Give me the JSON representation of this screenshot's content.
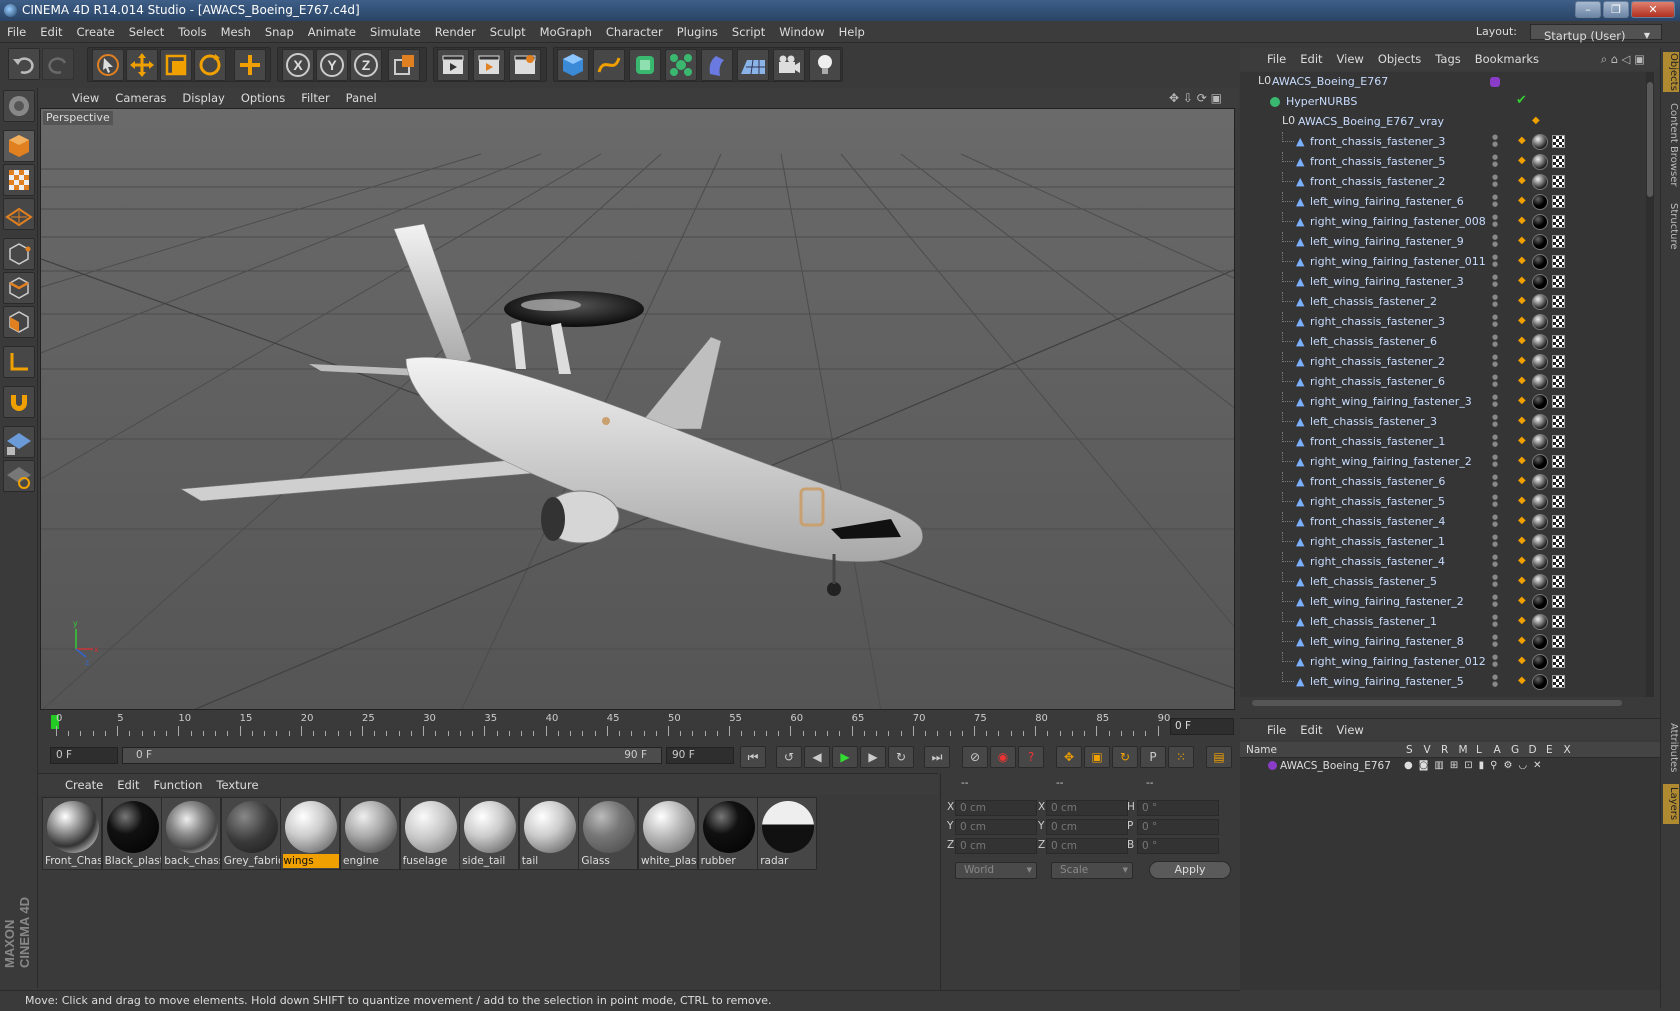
{
  "window": {
    "title": "CINEMA 4D R14.014 Studio - [AWACS_Boeing_E767.c4d]"
  },
  "menubar": {
    "items": [
      "File",
      "Edit",
      "Create",
      "Select",
      "Tools",
      "Mesh",
      "Snap",
      "Animate",
      "Simulate",
      "Render",
      "Sculpt",
      "MoGraph",
      "Character",
      "Plugins",
      "Script",
      "Window",
      "Help"
    ]
  },
  "layout": {
    "label": "Layout:",
    "value": "Startup (User)"
  },
  "viewport": {
    "menu": [
      "View",
      "Cameras",
      "Display",
      "Options",
      "Filter",
      "Panel"
    ],
    "label": "Perspective"
  },
  "timeline": {
    "ticks": [
      "0",
      "5",
      "10",
      "15",
      "20",
      "25",
      "30",
      "35",
      "40",
      "45",
      "50",
      "55",
      "60",
      "65",
      "70",
      "75",
      "80",
      "85",
      "90"
    ],
    "current_frame": "0 F"
  },
  "transport": {
    "start": "0 F",
    "range_start": "0 F",
    "range_end": "90 F",
    "end": "90 F"
  },
  "material_manager": {
    "menu": [
      "Create",
      "Edit",
      "Function",
      "Texture"
    ],
    "materials": [
      {
        "name": "Front_Chas",
        "style": "chrome"
      },
      {
        "name": "Black_plast",
        "style": "black"
      },
      {
        "name": "back_chass",
        "style": "chrome2"
      },
      {
        "name": "Grey_fabric",
        "style": "grey"
      },
      {
        "name": "wings",
        "style": "light",
        "selected": true
      },
      {
        "name": "engine",
        "style": "engine"
      },
      {
        "name": "fuselage",
        "style": "fuselage"
      },
      {
        "name": "side_tail",
        "style": "light"
      },
      {
        "name": "tail",
        "style": "light"
      },
      {
        "name": "Glass",
        "style": "glass"
      },
      {
        "name": "white_plas",
        "style": "white"
      },
      {
        "name": "rubber",
        "style": "black"
      },
      {
        "name": "radar",
        "style": "radar"
      }
    ]
  },
  "coordinates": {
    "col_headers": [
      "--",
      "--",
      "--"
    ],
    "rows": [
      {
        "a": "X",
        "av": "0 cm",
        "b": "X",
        "bv": "0 cm",
        "c": "H",
        "cv": "0 °"
      },
      {
        "a": "Y",
        "av": "0 cm",
        "b": "Y",
        "bv": "0 cm",
        "c": "P",
        "cv": "0 °"
      },
      {
        "a": "Z",
        "av": "0 cm",
        "b": "Z",
        "bv": "0 cm",
        "c": "B",
        "cv": "0 °"
      }
    ],
    "mode1": "World",
    "mode2": "Scale",
    "apply": "Apply"
  },
  "status": "Move: Click and drag to move elements. Hold down SHIFT to quantize movement / add to the selection in point mode, CTRL to remove.",
  "object_manager": {
    "menu": [
      "File",
      "Edit",
      "View",
      "Objects",
      "Tags",
      "Bookmarks"
    ],
    "root": "AWACS_Boeing_E767",
    "hypernurbs": "HyperNURBS",
    "group": "AWACS_Boeing_E767_vray",
    "children": [
      {
        "name": "front_chassis_fastener_3",
        "mat": "chrome"
      },
      {
        "name": "front_chassis_fastener_5",
        "mat": "chrome"
      },
      {
        "name": "front_chassis_fastener_2",
        "mat": "chrome"
      },
      {
        "name": "left_wing_fairing_fastener_6",
        "mat": "black"
      },
      {
        "name": "right_wing_fairing_fastener_008",
        "mat": "black"
      },
      {
        "name": "left_wing_fairing_fastener_9",
        "mat": "black"
      },
      {
        "name": "right_wing_fairing_fastener_011",
        "mat": "black"
      },
      {
        "name": "left_wing_fairing_fastener_3",
        "mat": "black"
      },
      {
        "name": "left_chassis_fastener_2",
        "mat": "chrome"
      },
      {
        "name": "right_chassis_fastener_3",
        "mat": "chrome"
      },
      {
        "name": "left_chassis_fastener_6",
        "mat": "chrome"
      },
      {
        "name": "right_chassis_fastener_2",
        "mat": "chrome"
      },
      {
        "name": "right_chassis_fastener_6",
        "mat": "chrome"
      },
      {
        "name": "right_wing_fairing_fastener_3",
        "mat": "black"
      },
      {
        "name": "left_chassis_fastener_3",
        "mat": "chrome"
      },
      {
        "name": "front_chassis_fastener_1",
        "mat": "chrome"
      },
      {
        "name": "right_wing_fairing_fastener_2",
        "mat": "black"
      },
      {
        "name": "front_chassis_fastener_6",
        "mat": "chrome"
      },
      {
        "name": "right_chassis_fastener_5",
        "mat": "chrome"
      },
      {
        "name": "front_chassis_fastener_4",
        "mat": "chrome"
      },
      {
        "name": "right_chassis_fastener_1",
        "mat": "chrome"
      },
      {
        "name": "right_chassis_fastener_4",
        "mat": "chrome"
      },
      {
        "name": "left_chassis_fastener_5",
        "mat": "chrome"
      },
      {
        "name": "left_wing_fairing_fastener_2",
        "mat": "black"
      },
      {
        "name": "left_chassis_fastener_1",
        "mat": "chrome"
      },
      {
        "name": "left_wing_fairing_fastener_8",
        "mat": "black"
      },
      {
        "name": "right_wing_fairing_fastener_012",
        "mat": "black"
      },
      {
        "name": "left_wing_fairing_fastener_5",
        "mat": "black"
      }
    ]
  },
  "right_tabs": [
    "Objects",
    "Content Browser",
    "Structure"
  ],
  "right_tabs_lower": [
    "Attributes",
    "Layers"
  ],
  "layer_manager": {
    "menu": [
      "File",
      "Edit",
      "View"
    ],
    "columns": [
      "Name",
      "S",
      "V",
      "R",
      "M",
      "L",
      "A",
      "G",
      "D",
      "E",
      "X"
    ],
    "layer": "AWACS_Boeing_E767"
  },
  "brand": "MAXON CINEMA 4D",
  "colors": {
    "accent": "#f0a000",
    "selection": "#4a6ea0",
    "tree_text": "#c8dcff",
    "purple": "#8a3cc8"
  }
}
